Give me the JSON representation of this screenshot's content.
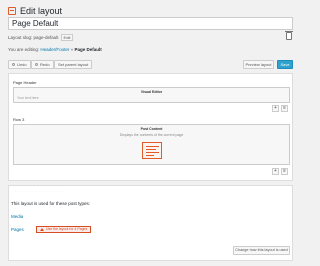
{
  "header": {
    "title": "Edit layout"
  },
  "layout_name": {
    "value": "Page Default"
  },
  "slug": {
    "label": "Layout slug: page-default",
    "edit_label": "Edit"
  },
  "breadcrumb": {
    "prefix": "You are editing:",
    "parent": "Header/Footer",
    "separator": "»",
    "current": "Page Default"
  },
  "toolbar": {
    "undo": "Undo",
    "redo": "Redo",
    "set_parent": "Set parent layout",
    "preview": "Preview layout",
    "save": "Save"
  },
  "editor": {
    "rows": [
      {
        "label": "Page Header",
        "cell_title": "Visual Editor",
        "cell_hint": "Your text here"
      },
      {
        "label": "Row 3",
        "cell_title": "Post Content",
        "cell_desc": "Displays the contents of the current page"
      }
    ],
    "row_add": "+",
    "row_menu": "≡"
  },
  "usage": {
    "blurred_heading": "· · · · · · · · · · · · · ·",
    "title": "This layout is used for these post types:",
    "items": [
      {
        "label": "Media"
      },
      {
        "label": "Pages",
        "warning": "Use the layout for 4 Pages"
      }
    ],
    "change_button": "Change how this layout is used"
  }
}
